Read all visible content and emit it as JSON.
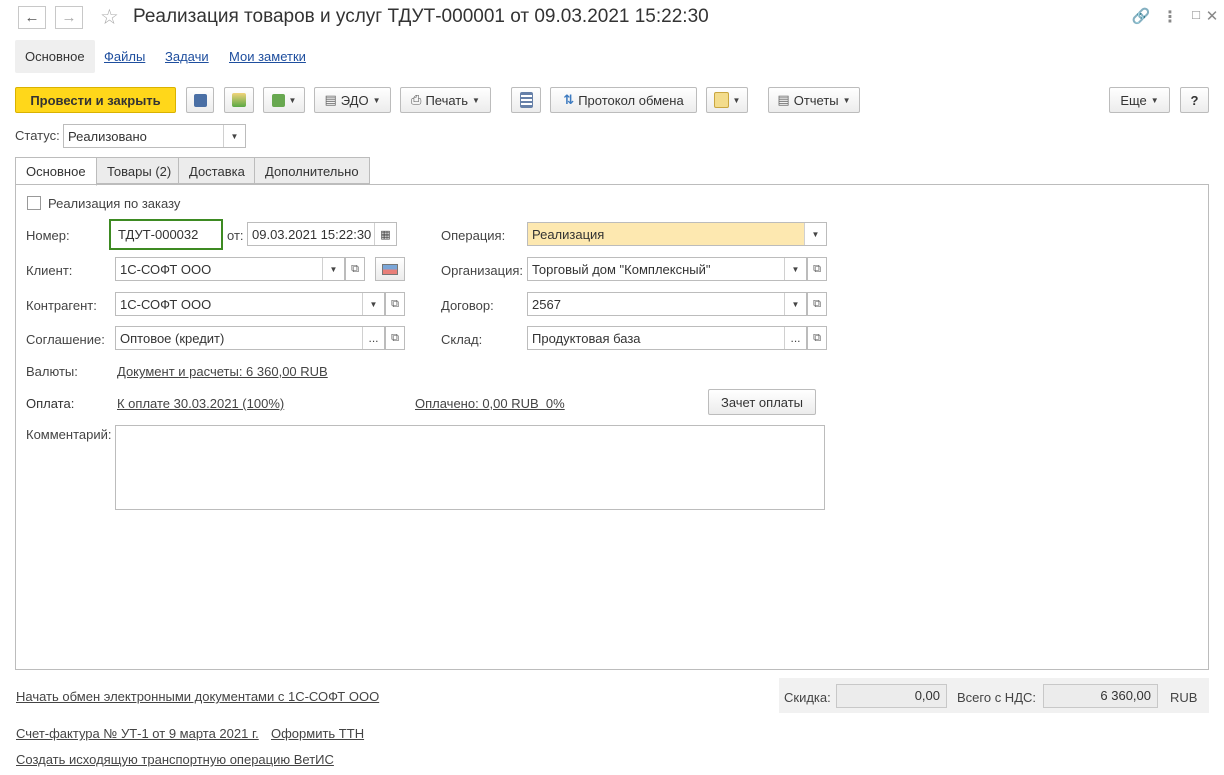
{
  "window": {
    "title": "Реализация товаров и услуг ТДУТ-000001 от 09.03.2021 15:22:30",
    "back_icon": "arrow-left-icon",
    "forward_icon": "arrow-right-icon",
    "star_icon": "star-icon"
  },
  "nav": {
    "main": "Основное",
    "files": "Файлы",
    "tasks": "Задачи",
    "notes": "Мои заметки"
  },
  "toolbar": {
    "post_close": "Провести и закрыть",
    "edo": "ЭДО",
    "print": "Печать",
    "exchange": "Протокол обмена",
    "reports": "Отчеты",
    "more": "Еще",
    "help": "?"
  },
  "status": {
    "label": "Статус:",
    "value": "Реализовано"
  },
  "tabs": [
    "Основное",
    "Товары (2)",
    "Доставка",
    "Дополнительно"
  ],
  "form": {
    "by_order": "Реализация по заказу",
    "number_label": "Номер:",
    "number_value": "ТДУТ-000032",
    "from_label": "от:",
    "date_value": "09.03.2021 15:22:30",
    "client_label": "Клиент:",
    "client_value": "1С-СОФТ ООО",
    "counterparty_label": "Контрагент:",
    "counterparty_value": "1С-СОФТ ООО",
    "agreement_label": "Соглашение:",
    "agreement_value": "Оптовое (кредит)",
    "operation_label": "Операция:",
    "operation_value": "Реализация",
    "org_label": "Организация:",
    "org_value": "Торговый дом \"Комплексный\"",
    "contract_label": "Договор:",
    "contract_value": "2567",
    "warehouse_label": "Склад:",
    "warehouse_value": "Продуктовая база",
    "currency_label": "Валюты:",
    "currency_link": "Документ и расчеты: 6 360,00 RUB",
    "payment_label": "Оплата:",
    "payment_link": "К оплате 30.03.2021 (100%)",
    "paid_link": "Оплачено: 0,00 RUB  0%",
    "offset_button": "Зачет оплаты",
    "comment_label": "Комментарий:"
  },
  "footer": {
    "edo_link": "Начать обмен электронными документами с 1С-СОФТ ООО",
    "invoice_link": "Счет-фактура № УТ-1 от 9 марта 2021 г.",
    "ttn_link": "Оформить ТТН",
    "vetis_link": "Создать исходящую транспортную операцию ВетИС",
    "discount_label": "Скидка:",
    "discount_value": "0,00",
    "total_label": "Всего с НДС:",
    "total_value": "6 360,00",
    "currency": "RUB"
  },
  "colors": {
    "accent": "#ffd71a",
    "link": "#1e4e9e",
    "focus": "#3d8a22",
    "operation_bg": "#fde8b0"
  }
}
